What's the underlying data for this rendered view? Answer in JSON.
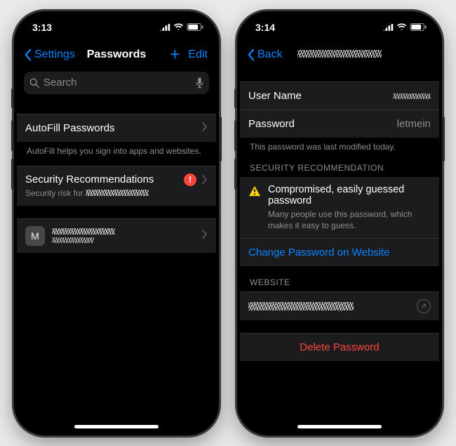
{
  "left": {
    "status_time": "3:13",
    "nav_back": "Settings",
    "nav_title": "Passwords",
    "nav_edit": "Edit",
    "search_placeholder": "Search",
    "autofill_label": "AutoFill Passwords",
    "autofill_footer": "AutoFill helps you sign into apps and websites.",
    "security_title": "Security Recommendations",
    "security_sub_prefix": "Security risk for ",
    "site_initial": "M"
  },
  "right": {
    "status_time": "3:14",
    "nav_back": "Back",
    "username_label": "User Name",
    "password_label": "Password",
    "password_value": "letmein",
    "modified_note": "This password was last modified today.",
    "section_recommendation": "SECURITY RECOMMENDATION",
    "warn_title": "Compromised, easily guessed password",
    "warn_body": "Many people use this password, which makes it easy to guess.",
    "change_link": "Change Password on Website",
    "section_website": "WEBSITE",
    "delete_label": "Delete Password"
  }
}
